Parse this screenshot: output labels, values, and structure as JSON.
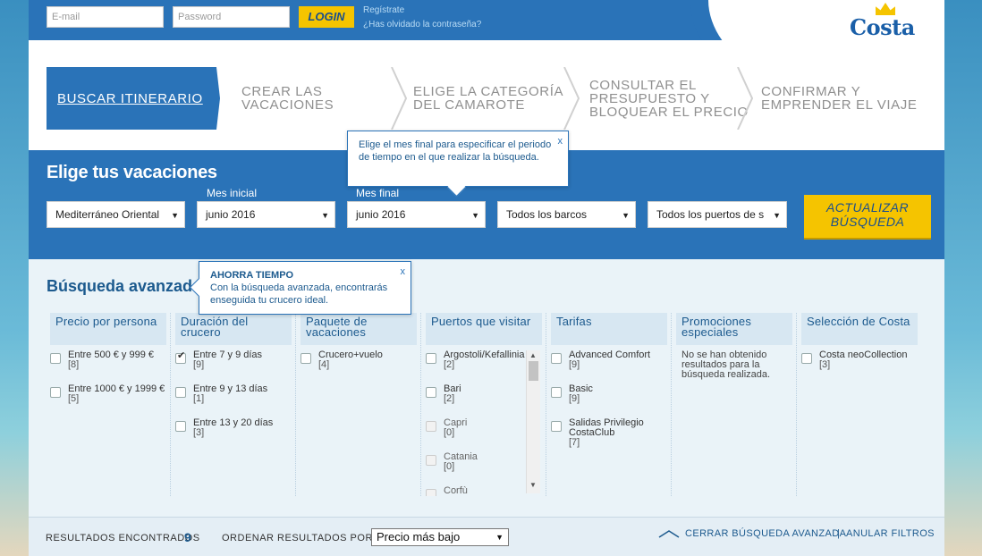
{
  "login": {
    "email_placeholder": "E-mail",
    "password_placeholder": "Password",
    "login_label": "LOGIN",
    "register": "Regístrate",
    "forgot": "¿Has olvidado la contraseña?"
  },
  "brand": {
    "logo_text": "Costa"
  },
  "steps": [
    {
      "label": "BUSCAR ITINERARIO"
    },
    {
      "label": "CREAR LAS VACACIONES"
    },
    {
      "label": "ELIGE LA CATEGORÍA DEL CAMAROTE"
    },
    {
      "label": "CONSULTAR EL PRESUPUESTO Y BLOQUEAR EL PRECIO"
    },
    {
      "label": "CONFIRMAR Y EMPRENDER EL VIAJE"
    }
  ],
  "search": {
    "title": "Elige tus vacaciones",
    "destination": "Mediterráneo Oriental",
    "start_month_label": "Mes inicial",
    "start_month": "junio 2016",
    "end_month_label": "Mes final",
    "end_month": "junio 2016",
    "ships": "Todos los barcos",
    "ports": "Todos los puertos de s",
    "update_label": "ACTUALIZAR BÚSQUEDA"
  },
  "tooltips": {
    "end_month": "Elige el mes final para especificar el periodo de tiempo en el que realizar la búsqueda.",
    "advanced_head": "AHORRA TIEMPO",
    "advanced_body": "Con la búsqueda avanzada, encontrarás enseguida tu crucero ideal.",
    "close": "x"
  },
  "advanced": {
    "title": "Búsqueda avanzada",
    "columns": [
      {
        "header": "Precio por persona",
        "options": [
          {
            "label": "Entre 500 € y 999 €",
            "count": "[8]",
            "checked": false
          },
          {
            "label": "Entre 1000 € y 1999 €",
            "count": "[5]",
            "checked": false
          }
        ]
      },
      {
        "header": "Duración del crucero",
        "options": [
          {
            "label": "Entre 7 y 9 días",
            "count": "[9]",
            "checked": true
          },
          {
            "label": "Entre 9 y 13 días",
            "count": "[1]",
            "checked": false
          },
          {
            "label": "Entre 13 y 20 días",
            "count": "[3]",
            "checked": false
          }
        ]
      },
      {
        "header": "Paquete de vacaciones",
        "options": [
          {
            "label": "Crucero+vuelo",
            "count": "[4]",
            "checked": false
          }
        ]
      },
      {
        "header": "Puertos que visitar",
        "options": [
          {
            "label": "Argostoli/Kefallinia",
            "count": "[2]",
            "checked": false
          },
          {
            "label": "Bari",
            "count": "[2]",
            "checked": false
          },
          {
            "label": "Capri",
            "count": "[0]",
            "checked": false
          },
          {
            "label": "Catania",
            "count": "[0]",
            "checked": false
          },
          {
            "label": "Corfù",
            "count": "",
            "checked": false
          }
        ]
      },
      {
        "header": "Tarifas",
        "options": [
          {
            "label": "Advanced Comfort",
            "count": "[9]",
            "checked": false
          },
          {
            "label": "Basic",
            "count": "[9]",
            "checked": false
          },
          {
            "label": "Salidas Privilegio CostaClub",
            "count": "[7]",
            "checked": false
          }
        ]
      },
      {
        "header": "Promociones especiales",
        "no_results": "No se han obtenido resultados para la búsqueda realizada."
      },
      {
        "header": "Selección de Costa",
        "options": [
          {
            "label": "Costa neoCollection",
            "count": "[3]",
            "checked": false
          }
        ]
      }
    ]
  },
  "footer": {
    "results_label": "RESULTADOS ENCONTRADOS",
    "results_count": "9",
    "order_label": "ORDENAR RESULTADOS POR:",
    "order_value": "Precio más bajo",
    "close_advanced": "CERRAR BÚSQUEDA AVANZADA",
    "separator": "|",
    "cancel_filters": "ANULAR FILTROS"
  },
  "colors": {
    "brand_blue": "#2a73b8",
    "accent_yellow": "#f5c400",
    "heading_blue": "#1c5a8e"
  }
}
